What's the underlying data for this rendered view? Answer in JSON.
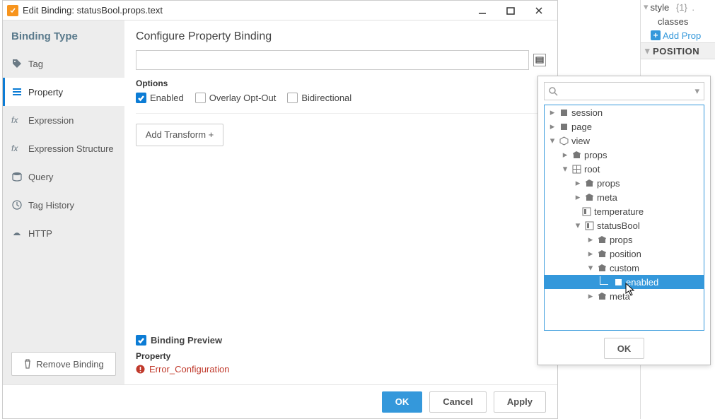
{
  "title": "Edit Binding: statusBool.props.text",
  "sidebar": {
    "header": "Binding Type",
    "items": [
      "Tag",
      "Property",
      "Expression",
      "Expression Structure",
      "Query",
      "Tag History",
      "HTTP"
    ]
  },
  "removeBtn": "Remove Binding",
  "main": {
    "header": "Configure Property Binding",
    "optionsLabel": "Options",
    "enabled": "Enabled",
    "overlay": "Overlay Opt-Out",
    "bidir": "Bidirectional",
    "addTransform": "Add Transform +"
  },
  "preview": {
    "title": "Binding Preview",
    "sub": "Property",
    "error": "Error_Configuration"
  },
  "footer": {
    "ok": "OK",
    "cancel": "Cancel",
    "apply": "Apply"
  },
  "tree": {
    "session": "session",
    "page": "page",
    "view": "view",
    "props": "props",
    "root": "root",
    "meta": "meta",
    "temperature": "temperature",
    "statusBool": "statusBool",
    "position": "position",
    "custom": "custom",
    "enabled": "enabled"
  },
  "popup": {
    "ok": "OK"
  },
  "inspector": {
    "style": "style",
    "styleVal": "{1}",
    "classes": "classes",
    "addProp": "Add Prop",
    "position": "POSITION"
  }
}
